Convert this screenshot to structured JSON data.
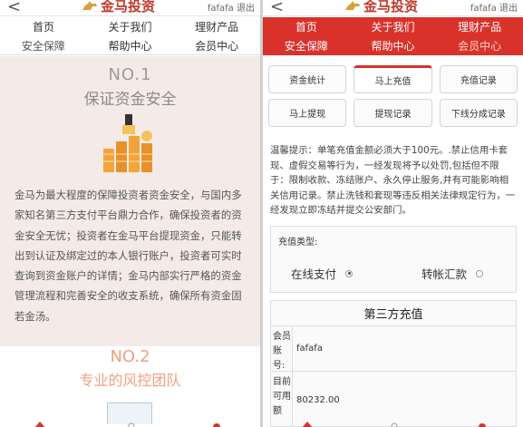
{
  "left": {
    "back": "<",
    "logo": "金马投资",
    "user": "fafafa",
    "logout": "退出",
    "nav": [
      "首页",
      "关于我们",
      "理财产品",
      "安全保障",
      "帮助中心",
      "会员中心"
    ],
    "section1": {
      "no": "NO.1",
      "subtitle": "保证资金安全",
      "body": "金马为最大程度的保障投资者资金安全，与国内多家知名第三方支付平台鼎力合作，确保投资者的资金安全无忧；投资者在金马平台提现资金，只能转出到认证及绑定过的本人银行账户，投资者可实时查询到资金账户的详情；金马内部实行严格的资金管理流程和完善安全的收支系统，确保所有资金固若金汤。"
    },
    "section2": {
      "no": "NO.2",
      "subtitle": "专业的风控团队"
    }
  },
  "right": {
    "back": "<",
    "logo": "金马投资",
    "user": "fafafa",
    "logout": "退出",
    "nav": [
      "首页",
      "关于我们",
      "理财产品",
      "安全保障",
      "帮助中心",
      "会员中心"
    ],
    "tabs": [
      "资金统计",
      "马上充值",
      "充值记录",
      "马上提现",
      "提现记录",
      "下线分成记录"
    ],
    "notice": "温馨提示：单笔充值金额必须大于100元。.禁止信用卡套现、虚假交易等行为，一经发现将予以处罚,包括但不限于：限制收款、冻结账户、永久停止服务,并有可能影响相关信用记录。禁止洗钱和套现等违反相关法律规定行为，一经发现立即冻结并提交公安部门。",
    "recharge_type_label": "充值类型:",
    "options": [
      "在线支付",
      "转帐汇款"
    ],
    "third_party": {
      "title": "第三方充值",
      "member_label": "会员账号:",
      "member_value": "fafafa",
      "balance_label": "目前可用额",
      "balance_value": "80232.00"
    }
  },
  "colors": {
    "accent": "#d9322b",
    "cream": "#f4ebe8",
    "orange_text": "#f0a080"
  }
}
